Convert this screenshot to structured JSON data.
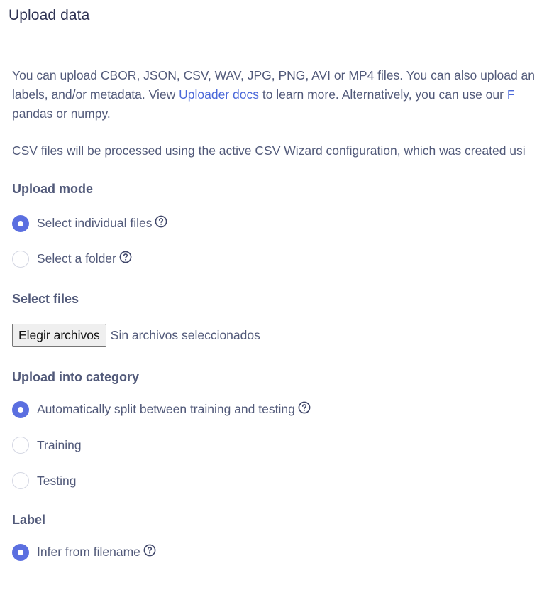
{
  "header": {
    "title": "Upload data"
  },
  "intro": {
    "line1": "You can upload CBOR, JSON, CSV, WAV, JPG, PNG, AVI or MP4 files. You can also upload an a",
    "line2_pre": "labels, and/or metadata. View ",
    "line2_link": "Uploader docs",
    "line2_post": " to learn more. Alternatively, you can use our ",
    "line2_link2": "F",
    "line3": "pandas or numpy."
  },
  "csv_note": "CSV files will be processed using the active CSV Wizard configuration, which was created usi",
  "upload_mode": {
    "heading": "Upload mode",
    "options": [
      {
        "label": "Select individual files",
        "checked": true,
        "help": true
      },
      {
        "label": "Select a folder",
        "checked": false,
        "help": true
      }
    ]
  },
  "select_files": {
    "heading": "Select files",
    "button_label": "Elegir archivos",
    "status": "Sin archivos seleccionados"
  },
  "category": {
    "heading": "Upload into category",
    "options": [
      {
        "label": "Automatically split between training and testing",
        "checked": true,
        "help": true
      },
      {
        "label": "Training",
        "checked": false,
        "help": false
      },
      {
        "label": "Testing",
        "checked": false,
        "help": false
      }
    ]
  },
  "label": {
    "heading": "Label",
    "options": [
      {
        "label": "Infer from filename",
        "checked": true,
        "help": true
      }
    ]
  },
  "colors": {
    "accent": "#5b6fe0",
    "link": "#4a68d9",
    "text": "#525a7a",
    "title": "#2e3253"
  },
  "icons": {
    "help": "question-circle-icon"
  }
}
